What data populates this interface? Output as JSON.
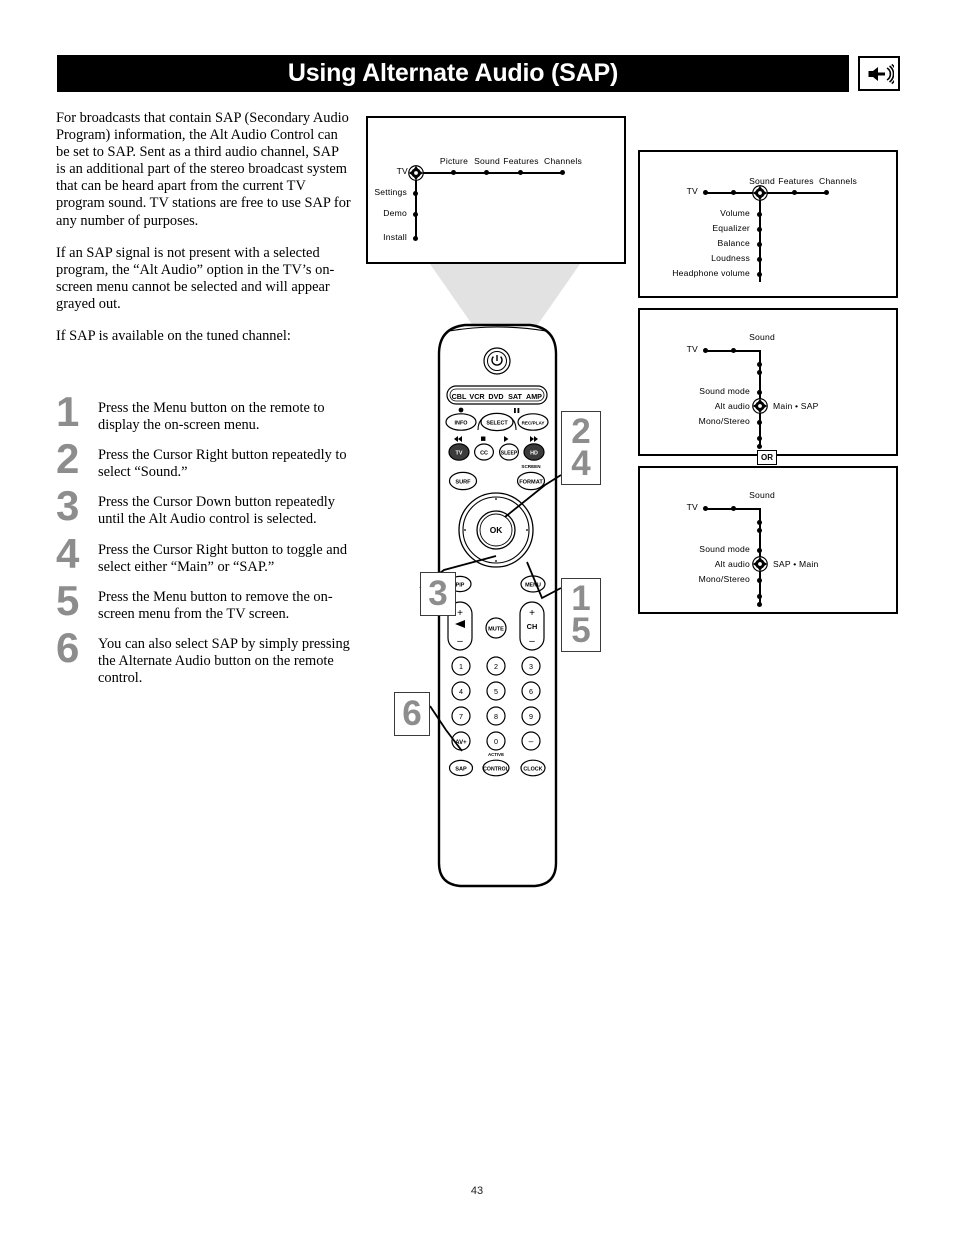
{
  "header": {
    "title": "Using Alternate Audio (SAP)",
    "icon": "speaker-sound-icon"
  },
  "body": {
    "paragraphs": [
      "For broadcasts that contain SAP (Secondary Audio Program) information, the Alt Audio Control can be set to SAP. Sent as a third audio channel, SAP is an additional part of the stereo broadcast system that can be heard apart from the current TV program sound. TV stations are free to use SAP for any number of purposes.",
      "If an SAP signal is not present with a selected program, the “Alt Audio” option in the TV’s on-screen menu cannot be selected and will appear grayed out.",
      "If SAP is available on the tuned channel:"
    ]
  },
  "steps": [
    {
      "num": "1",
      "text": "Press the Menu button on the remote to display the on-screen menu."
    },
    {
      "num": "2",
      "text": "Press the Cursor Right button repeatedly to select “Sound.”"
    },
    {
      "num": "3",
      "text": "Press the Cursor Down button repeatedly until the Alt Audio control is selected."
    },
    {
      "num": "4",
      "text": "Press the Cursor Right button to toggle and select either “Main” or “SAP.”"
    },
    {
      "num": "5",
      "text": "Press the Menu button to remove the on-screen menu from the TV screen."
    },
    {
      "num": "6",
      "text": "You can also select SAP by simply pressing the Alternate Audio button on the remote control."
    }
  ],
  "menus": {
    "box1": {
      "root": "TV",
      "horizontal": [
        "Picture",
        "Sound",
        "Features",
        "Channels"
      ],
      "vertical": [
        "Settings",
        "Demo",
        "Install"
      ],
      "cursor_on": "TV"
    },
    "box2": {
      "root": "TV",
      "horizontal": [
        "Sound",
        "Features",
        "Channels"
      ],
      "vertical": [
        "Volume",
        "Equalizer",
        "Balance",
        "Loudness",
        "Headphone volume"
      ],
      "cursor_on": "Sound"
    },
    "box3": {
      "root": "TV",
      "column_title": "Sound",
      "vertical": [
        "Sound mode",
        "Alt audio",
        "Mono/Stereo"
      ],
      "cursor_on": "Alt audio",
      "value": "Main • SAP"
    },
    "box4": {
      "root": "TV",
      "column_title": "Sound",
      "vertical": [
        "Sound mode",
        "Alt audio",
        "Mono/Stereo"
      ],
      "cursor_on": "Alt audio",
      "value": "SAP • Main"
    },
    "or_label": "OR"
  },
  "remote": {
    "power": "power-icon",
    "device_keys": [
      "CBL",
      "VCR",
      "DVD",
      "SAT",
      "AMP"
    ],
    "row_info": [
      "INFO",
      "SELECT",
      "REC/PLAY"
    ],
    "row_mode": [
      "TV",
      "CC",
      "SLEEP",
      "HD"
    ],
    "surf": "SURF",
    "screen_format_top": "SCREEN",
    "screen_format": "FORMAT",
    "ok": "OK",
    "pip": "PIP",
    "menu": "MENU",
    "volume": {
      "plus": "+",
      "minus": "–",
      "icon": "volume-icon"
    },
    "mute": "MUTE",
    "channel": {
      "plus": "+",
      "label": "CH",
      "minus": "–"
    },
    "keypad": [
      "1",
      "2",
      "3",
      "4",
      "5",
      "6",
      "7",
      "8",
      "9",
      "AV+",
      "0",
      "–"
    ],
    "bottom_row": [
      "SAP",
      "CONTROL",
      "CLOCK"
    ],
    "active_label": "ACTIVE"
  },
  "callouts": [
    {
      "name": "callout-2-4",
      "lines": [
        "2",
        "4"
      ]
    },
    {
      "name": "callout-1-5",
      "lines": [
        "1",
        "5"
      ]
    },
    {
      "name": "callout-3",
      "lines": [
        "3"
      ]
    },
    {
      "name": "callout-6",
      "lines": [
        "6"
      ]
    }
  ],
  "footer": {
    "page_number": "43"
  },
  "colors": {
    "header_bg": "#000000",
    "step_number": "#8d8d8d",
    "beam": "#e2e2e2",
    "dark_button": "#3b3b3b"
  }
}
